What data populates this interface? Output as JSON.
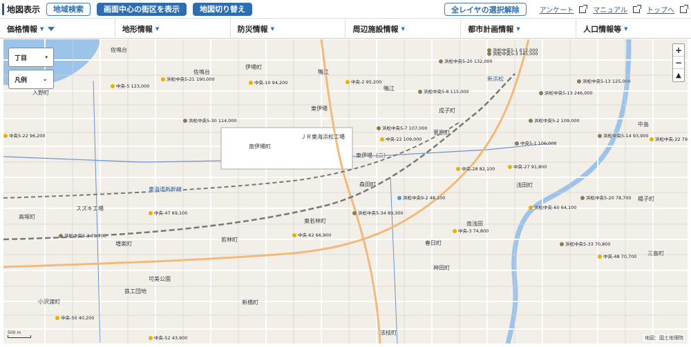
{
  "header": {
    "title": "地図表示",
    "buttons": {
      "area_search": "地域検索",
      "show_center": "画面中心の街区を表示",
      "switch_map": "地図切り替え"
    },
    "clear_layers": "全レイヤの選択解除",
    "links": {
      "survey": "アンケート",
      "manual": "マニュアル",
      "top": "トップへ"
    }
  },
  "filters": [
    "価格情報",
    "地形情報",
    "防災情報",
    "周辺施設情報",
    "都市計画情報",
    "人口情報等"
  ],
  "map_controls": {
    "chome": "丁目",
    "legend": "凡例",
    "zoom_in": "+",
    "zoom_out": "−",
    "north": "▲"
  },
  "scale": "500 m",
  "credit": "地図：国土地理院",
  "colors": {
    "accent": "#2c6db3",
    "water": "#9cc3ea",
    "road_major": "#f2b97a",
    "residential_dot": "#e8b100",
    "commercial_dot": "#8a7a55"
  },
  "price_labels": [
    {
      "text": "浜松中央5-1 612,000",
      "color": "#8a7a55"
    },
    {
      "text": "浜松中央5-20 132,000",
      "color": "#8a7a55"
    },
    {
      "text": "浜松中央5-3 345,000",
      "color": "#8a7a55"
    },
    {
      "text": "浜松中央5-13 125,000",
      "color": "#8a7a55"
    },
    {
      "text": "浜松中央5-21 190,000",
      "color": "#e8b100"
    },
    {
      "text": "中央-5 123,000",
      "color": "#e8b100"
    },
    {
      "text": "中央-10 94,200",
      "color": "#e8b100"
    },
    {
      "text": "中央-2 95,200",
      "color": "#e8b100"
    },
    {
      "text": "浜松中央5-8 115,000",
      "color": "#8a7a55"
    },
    {
      "text": "浜松中央5-13 246,000",
      "color": "#8a7a55"
    },
    {
      "text": "浜松中央5-30 114,000",
      "color": "#8a7a55"
    },
    {
      "text": "浜松中央5-2 109,000",
      "color": "#8a7a55"
    },
    {
      "text": "浜松中央5-7 107,000",
      "color": "#8a7a55"
    },
    {
      "text": "中央-22 109,000",
      "color": "#e8b100"
    },
    {
      "text": "中央5-22 96,200",
      "color": "#e8b100"
    },
    {
      "text": "浜松中央5-14 93,900",
      "color": "#8a7a55"
    },
    {
      "text": "浜松中央-22 79,4",
      "color": "#e8b100"
    },
    {
      "text": "中央5-1 106,000",
      "color": "#8a7a55"
    },
    {
      "text": "中央-28 82,100",
      "color": "#e8b100"
    },
    {
      "text": "中央-27 91,800",
      "color": "#e8b100"
    },
    {
      "text": "浜松中央9-2 48,100",
      "color": "#3ca0e8"
    },
    {
      "text": "浜松中央5-20 78,700",
      "color": "#8a7a55"
    },
    {
      "text": "中央-47 69,100",
      "color": "#e8b100"
    },
    {
      "text": "浜松中央-60 64,100",
      "color": "#e8b100"
    },
    {
      "text": "浜松中央5-34 89,300",
      "color": "#8a7a55"
    },
    {
      "text": "浜松中央5-3 70,700",
      "color": "#8a7a55"
    },
    {
      "text": "中央-62 66,900",
      "color": "#e8b100"
    },
    {
      "text": "中央-3 74,800",
      "color": "#e8b100"
    },
    {
      "text": "浜松中央5-33 70,800",
      "color": "#8a7a55"
    },
    {
      "text": "中央-48 70,700",
      "color": "#e8b100"
    },
    {
      "text": "中央-50 40,200",
      "color": "#e8b100"
    },
    {
      "text": "中央-52 43,900",
      "color": "#e8b100"
    }
  ],
  "places": [
    "佐鳴台",
    "入野町",
    "佐鳴台",
    "伊場町",
    "鴨江",
    "鴨江",
    "東伊場",
    "南伊場町",
    "ＪＲ東海浜松工場",
    "東伊場（二）",
    "森田町",
    "東海道新幹線",
    "スズキ工場",
    "高塚町",
    "増楽町",
    "若林町",
    "東若林町",
    "可美公園",
    "鉄工団地",
    "小沢渡町",
    "新橋町",
    "法枝町",
    "南浅田",
    "春日町",
    "神田町",
    "浅田町",
    "菅原町",
    "成子町",
    "中島",
    "三島町",
    "楊子町",
    "新浜松"
  ]
}
